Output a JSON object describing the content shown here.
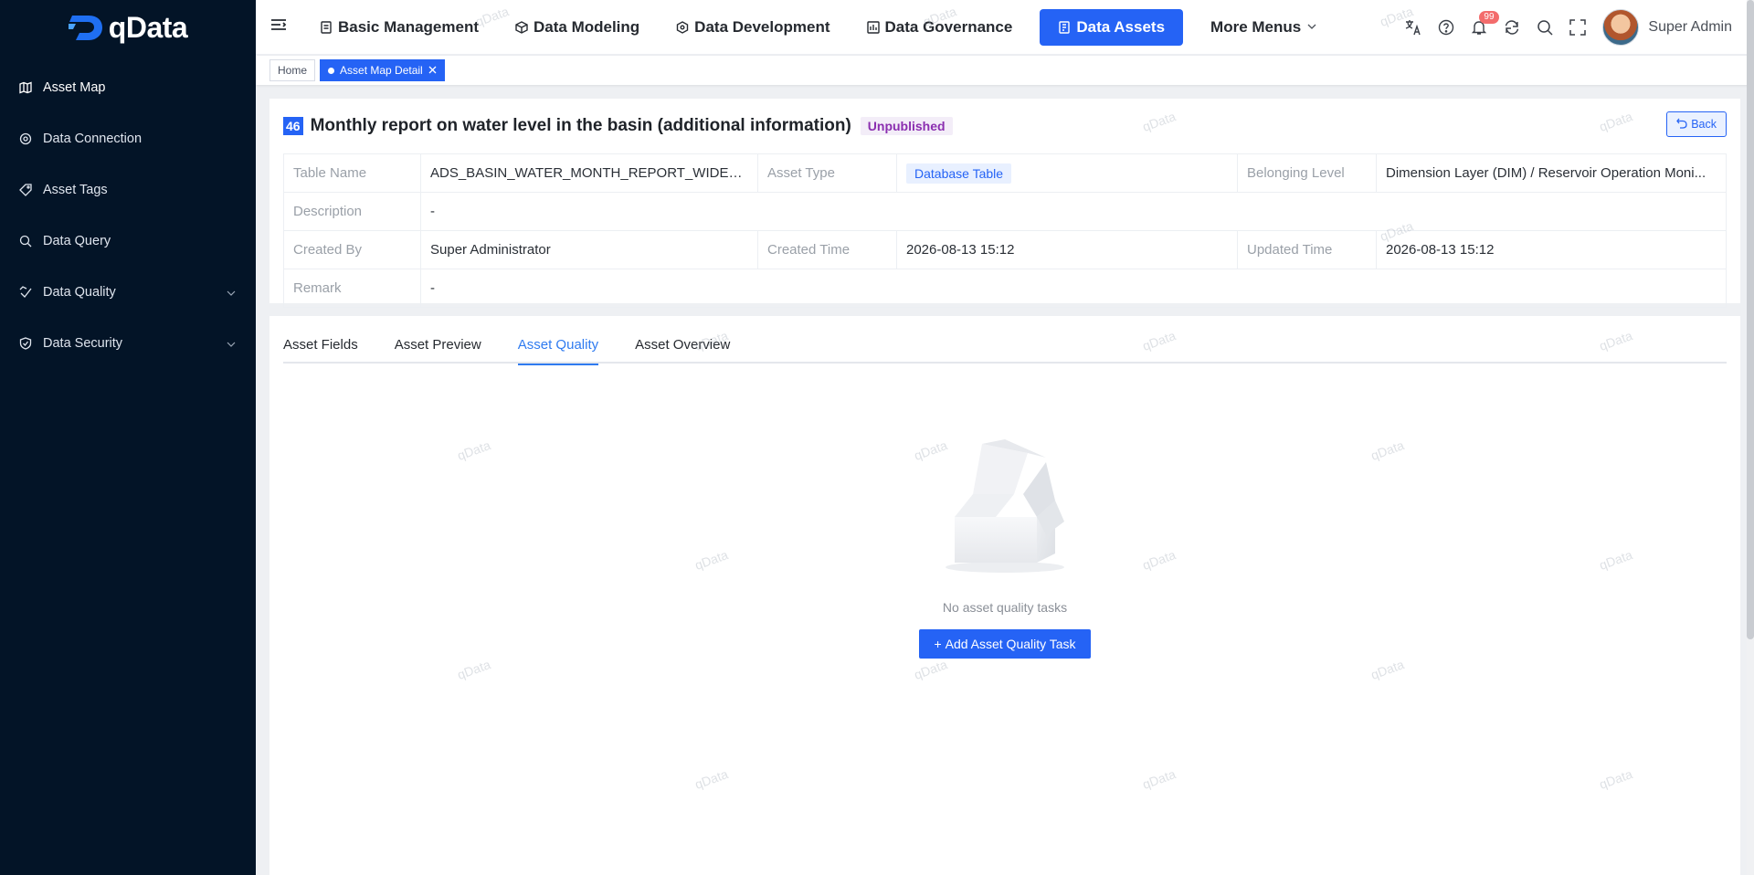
{
  "app": {
    "logo_text": "qData"
  },
  "sidebar": {
    "items": [
      {
        "label": "Asset Map",
        "icon": "map-icon"
      },
      {
        "label": "Data Connection",
        "icon": "connection-icon"
      },
      {
        "label": "Asset Tags",
        "icon": "tag-icon"
      },
      {
        "label": "Data Query",
        "icon": "search-query-icon"
      },
      {
        "label": "Data Quality",
        "icon": "quality-icon"
      },
      {
        "label": "Data Security",
        "icon": "shield-icon"
      }
    ]
  },
  "header": {
    "nav": [
      {
        "label": "Basic Management"
      },
      {
        "label": "Data Modeling"
      },
      {
        "label": "Data Development"
      },
      {
        "label": "Data Governance"
      },
      {
        "label": "Data Assets"
      },
      {
        "label": "More Menus"
      }
    ],
    "notification_count": "99",
    "username": "Super Admin"
  },
  "tags": {
    "home": "Home",
    "current": "Asset Map Detail"
  },
  "asset": {
    "id": "46",
    "title": "Monthly report on water level in the basin (additional information)",
    "status": "Unpublished",
    "back_label": "Back",
    "fields": {
      "table_name_label": "Table Name",
      "table_name": "ADS_BASIN_WATER_MONTH_REPORT_WIDE_A...",
      "asset_type_label": "Asset Type",
      "asset_type": "Database Table",
      "belonging_level_label": "Belonging Level",
      "belonging_level": "Dimension Layer (DIM) / Reservoir Operation Moni...",
      "description_label": "Description",
      "description": "-",
      "created_by_label": "Created By",
      "created_by": "Super Administrator",
      "created_time_label": "Created Time",
      "created_time": "2026-08-13 15:12",
      "updated_time_label": "Updated Time",
      "updated_time": "2026-08-13 15:12",
      "remark_label": "Remark",
      "remark": "-"
    }
  },
  "tabs": [
    {
      "label": "Asset Fields"
    },
    {
      "label": "Asset Preview"
    },
    {
      "label": "Asset Quality"
    },
    {
      "label": "Asset Overview"
    }
  ],
  "empty": {
    "text": "No asset quality tasks",
    "button": "Add Asset Quality Task"
  },
  "watermark": "qData",
  "colors": {
    "sidebar_bg": "#031427",
    "primary": "#2563f5",
    "status_purple": "#8b2fb0"
  }
}
